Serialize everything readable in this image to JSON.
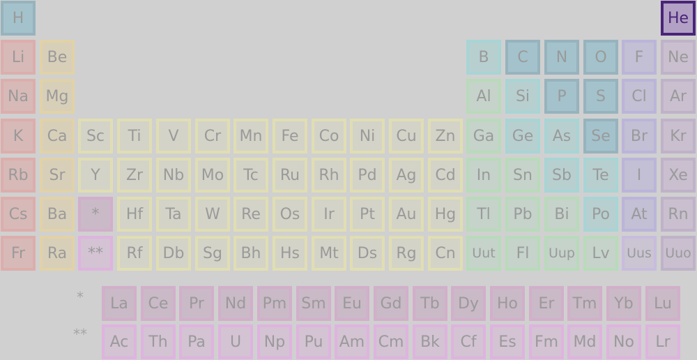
{
  "colors": {
    "nonmetal": {
      "bg": "#a3c2cc",
      "border": "#97b3bd"
    },
    "noble": {
      "bg": "#c9bfcf",
      "border": "#bfb2c8"
    },
    "alkali": {
      "bg": "#d7b9b7",
      "border": "#dcaeab"
    },
    "alkaline": {
      "bg": "#d8cfb9",
      "border": "#e1d2a7"
    },
    "transition": {
      "bg": "#d4d3c8",
      "border": "#e0deb2"
    },
    "post": {
      "bg": "#c5d3ca",
      "border": "#b8dbb9"
    },
    "metalloid": {
      "bg": "#b8cfcf",
      "border": "#a7d5d5"
    },
    "halogen": {
      "bg": "#c3bfd4",
      "border": "#bbb4da"
    },
    "lanthanide": {
      "bg": "#cab9c6",
      "border": "#d2afca"
    },
    "actinide": {
      "bg": "#d3c3d3",
      "border": "#dfb3df"
    },
    "unknown": {
      "bg": "#cbc5d3",
      "border": "#c8bcdd"
    },
    "helium": {
      "bg": "#b2a0c5",
      "border": "#4a2478",
      "text": "#4a2478"
    }
  },
  "elements": [
    {
      "s": "H",
      "c": 0,
      "r": 0,
      "cat": "nonmetal"
    },
    {
      "s": "He",
      "c": 17,
      "r": 0,
      "cat": "helium"
    },
    {
      "s": "Li",
      "c": 0,
      "r": 1,
      "cat": "alkali"
    },
    {
      "s": "Be",
      "c": 1,
      "r": 1,
      "cat": "alkaline"
    },
    {
      "s": "B",
      "c": 12,
      "r": 1,
      "cat": "metalloid"
    },
    {
      "s": "C",
      "c": 13,
      "r": 1,
      "cat": "nonmetal"
    },
    {
      "s": "N",
      "c": 14,
      "r": 1,
      "cat": "nonmetal"
    },
    {
      "s": "O",
      "c": 15,
      "r": 1,
      "cat": "nonmetal"
    },
    {
      "s": "F",
      "c": 16,
      "r": 1,
      "cat": "halogen"
    },
    {
      "s": "Ne",
      "c": 17,
      "r": 1,
      "cat": "noble"
    },
    {
      "s": "Na",
      "c": 0,
      "r": 2,
      "cat": "alkali"
    },
    {
      "s": "Mg",
      "c": 1,
      "r": 2,
      "cat": "alkaline"
    },
    {
      "s": "Al",
      "c": 12,
      "r": 2,
      "cat": "post"
    },
    {
      "s": "Si",
      "c": 13,
      "r": 2,
      "cat": "metalloid"
    },
    {
      "s": "P",
      "c": 14,
      "r": 2,
      "cat": "nonmetal"
    },
    {
      "s": "S",
      "c": 15,
      "r": 2,
      "cat": "nonmetal"
    },
    {
      "s": "Cl",
      "c": 16,
      "r": 2,
      "cat": "halogen"
    },
    {
      "s": "Ar",
      "c": 17,
      "r": 2,
      "cat": "noble"
    },
    {
      "s": "K",
      "c": 0,
      "r": 3,
      "cat": "alkali"
    },
    {
      "s": "Ca",
      "c": 1,
      "r": 3,
      "cat": "alkaline"
    },
    {
      "s": "Sc",
      "c": 2,
      "r": 3,
      "cat": "transition"
    },
    {
      "s": "Ti",
      "c": 3,
      "r": 3,
      "cat": "transition"
    },
    {
      "s": "V",
      "c": 4,
      "r": 3,
      "cat": "transition"
    },
    {
      "s": "Cr",
      "c": 5,
      "r": 3,
      "cat": "transition"
    },
    {
      "s": "Mn",
      "c": 6,
      "r": 3,
      "cat": "transition"
    },
    {
      "s": "Fe",
      "c": 7,
      "r": 3,
      "cat": "transition"
    },
    {
      "s": "Co",
      "c": 8,
      "r": 3,
      "cat": "transition"
    },
    {
      "s": "Ni",
      "c": 9,
      "r": 3,
      "cat": "transition"
    },
    {
      "s": "Cu",
      "c": 10,
      "r": 3,
      "cat": "transition"
    },
    {
      "s": "Zn",
      "c": 11,
      "r": 3,
      "cat": "transition"
    },
    {
      "s": "Ga",
      "c": 12,
      "r": 3,
      "cat": "post"
    },
    {
      "s": "Ge",
      "c": 13,
      "r": 3,
      "cat": "metalloid"
    },
    {
      "s": "As",
      "c": 14,
      "r": 3,
      "cat": "metalloid"
    },
    {
      "s": "Se",
      "c": 15,
      "r": 3,
      "cat": "nonmetal"
    },
    {
      "s": "Br",
      "c": 16,
      "r": 3,
      "cat": "halogen"
    },
    {
      "s": "Kr",
      "c": 17,
      "r": 3,
      "cat": "noble"
    },
    {
      "s": "Rb",
      "c": 0,
      "r": 4,
      "cat": "alkali"
    },
    {
      "s": "Sr",
      "c": 1,
      "r": 4,
      "cat": "alkaline"
    },
    {
      "s": "Y",
      "c": 2,
      "r": 4,
      "cat": "transition"
    },
    {
      "s": "Zr",
      "c": 3,
      "r": 4,
      "cat": "transition"
    },
    {
      "s": "Nb",
      "c": 4,
      "r": 4,
      "cat": "transition"
    },
    {
      "s": "Mo",
      "c": 5,
      "r": 4,
      "cat": "transition"
    },
    {
      "s": "Tc",
      "c": 6,
      "r": 4,
      "cat": "transition"
    },
    {
      "s": "Ru",
      "c": 7,
      "r": 4,
      "cat": "transition"
    },
    {
      "s": "Rh",
      "c": 8,
      "r": 4,
      "cat": "transition"
    },
    {
      "s": "Pd",
      "c": 9,
      "r": 4,
      "cat": "transition"
    },
    {
      "s": "Ag",
      "c": 10,
      "r": 4,
      "cat": "transition"
    },
    {
      "s": "Cd",
      "c": 11,
      "r": 4,
      "cat": "transition"
    },
    {
      "s": "In",
      "c": 12,
      "r": 4,
      "cat": "post"
    },
    {
      "s": "Sn",
      "c": 13,
      "r": 4,
      "cat": "post"
    },
    {
      "s": "Sb",
      "c": 14,
      "r": 4,
      "cat": "metalloid"
    },
    {
      "s": "Te",
      "c": 15,
      "r": 4,
      "cat": "metalloid"
    },
    {
      "s": "I",
      "c": 16,
      "r": 4,
      "cat": "halogen"
    },
    {
      "s": "Xe",
      "c": 17,
      "r": 4,
      "cat": "noble"
    },
    {
      "s": "Cs",
      "c": 0,
      "r": 5,
      "cat": "alkali"
    },
    {
      "s": "Ba",
      "c": 1,
      "r": 5,
      "cat": "alkaline"
    },
    {
      "s": "*",
      "c": 2,
      "r": 5,
      "cat": "lanthanide"
    },
    {
      "s": "Hf",
      "c": 3,
      "r": 5,
      "cat": "transition"
    },
    {
      "s": "Ta",
      "c": 4,
      "r": 5,
      "cat": "transition"
    },
    {
      "s": "W",
      "c": 5,
      "r": 5,
      "cat": "transition"
    },
    {
      "s": "Re",
      "c": 6,
      "r": 5,
      "cat": "transition"
    },
    {
      "s": "Os",
      "c": 7,
      "r": 5,
      "cat": "transition"
    },
    {
      "s": "Ir",
      "c": 8,
      "r": 5,
      "cat": "transition"
    },
    {
      "s": "Pt",
      "c": 9,
      "r": 5,
      "cat": "transition"
    },
    {
      "s": "Au",
      "c": 10,
      "r": 5,
      "cat": "transition"
    },
    {
      "s": "Hg",
      "c": 11,
      "r": 5,
      "cat": "transition"
    },
    {
      "s": "Tl",
      "c": 12,
      "r": 5,
      "cat": "post"
    },
    {
      "s": "Pb",
      "c": 13,
      "r": 5,
      "cat": "post"
    },
    {
      "s": "Bi",
      "c": 14,
      "r": 5,
      "cat": "post"
    },
    {
      "s": "Po",
      "c": 15,
      "r": 5,
      "cat": "metalloid"
    },
    {
      "s": "At",
      "c": 16,
      "r": 5,
      "cat": "halogen"
    },
    {
      "s": "Rn",
      "c": 17,
      "r": 5,
      "cat": "noble"
    },
    {
      "s": "Fr",
      "c": 0,
      "r": 6,
      "cat": "alkali"
    },
    {
      "s": "Ra",
      "c": 1,
      "r": 6,
      "cat": "alkaline"
    },
    {
      "s": "**",
      "c": 2,
      "r": 6,
      "cat": "actinide"
    },
    {
      "s": "Rf",
      "c": 3,
      "r": 6,
      "cat": "transition"
    },
    {
      "s": "Db",
      "c": 4,
      "r": 6,
      "cat": "transition"
    },
    {
      "s": "Sg",
      "c": 5,
      "r": 6,
      "cat": "transition"
    },
    {
      "s": "Bh",
      "c": 6,
      "r": 6,
      "cat": "transition"
    },
    {
      "s": "Hs",
      "c": 7,
      "r": 6,
      "cat": "transition"
    },
    {
      "s": "Mt",
      "c": 8,
      "r": 6,
      "cat": "transition"
    },
    {
      "s": "Ds",
      "c": 9,
      "r": 6,
      "cat": "transition"
    },
    {
      "s": "Rg",
      "c": 10,
      "r": 6,
      "cat": "transition"
    },
    {
      "s": "Cn",
      "c": 11,
      "r": 6,
      "cat": "transition"
    },
    {
      "s": "Uut",
      "c": 12,
      "r": 6,
      "cat": "post"
    },
    {
      "s": "Fl",
      "c": 13,
      "r": 6,
      "cat": "post"
    },
    {
      "s": "Uup",
      "c": 14,
      "r": 6,
      "cat": "post"
    },
    {
      "s": "Lv",
      "c": 15,
      "r": 6,
      "cat": "post"
    },
    {
      "s": "Uus",
      "c": 16,
      "r": 6,
      "cat": "unknown"
    },
    {
      "s": "Uuo",
      "c": 17,
      "r": 6,
      "cat": "noble"
    }
  ],
  "lanthanides_marker": "*",
  "actinides_marker": "**",
  "lanthanides": [
    "La",
    "Ce",
    "Pr",
    "Nd",
    "Pm",
    "Sm",
    "Eu",
    "Gd",
    "Tb",
    "Dy",
    "Ho",
    "Er",
    "Tm",
    "Yb",
    "Lu"
  ],
  "actinides": [
    "Ac",
    "Th",
    "Pa",
    "U",
    "Np",
    "Pu",
    "Am",
    "Cm",
    "Bk",
    "Cf",
    "Es",
    "Fm",
    "Md",
    "No",
    "Lr"
  ]
}
